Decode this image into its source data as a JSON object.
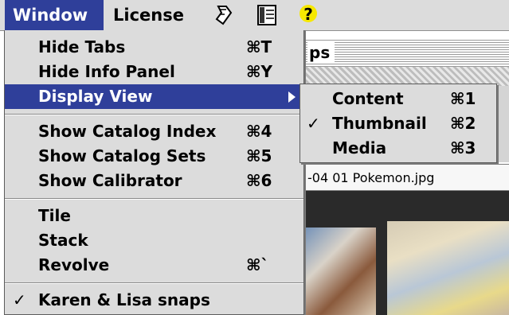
{
  "menubar": {
    "window": "Window",
    "license": "License"
  },
  "background_window": {
    "title_fragment": "ps",
    "filename": "-04 01 Pokemon.jpg"
  },
  "menu": {
    "items": [
      {
        "label": "Hide Tabs",
        "shortcut": "⌘T"
      },
      {
        "label": "Hide Info Panel",
        "shortcut": "⌘Y"
      },
      {
        "label": "Display View",
        "shortcut": ""
      },
      {
        "label": "Show Catalog Index",
        "shortcut": "⌘4"
      },
      {
        "label": "Show Catalog Sets",
        "shortcut": "⌘5"
      },
      {
        "label": "Show Calibrator",
        "shortcut": "⌘6"
      },
      {
        "label": "Tile",
        "shortcut": ""
      },
      {
        "label": "Stack",
        "shortcut": ""
      },
      {
        "label": "Revolve",
        "shortcut": "⌘`"
      },
      {
        "label": "Karen & Lisa snaps",
        "shortcut": "",
        "check": "✓"
      }
    ]
  },
  "submenu": {
    "items": [
      {
        "label": "Content",
        "shortcut": "⌘1",
        "check": ""
      },
      {
        "label": "Thumbnail",
        "shortcut": "⌘2",
        "check": "✓"
      },
      {
        "label": "Media",
        "shortcut": "⌘3",
        "check": ""
      }
    ]
  },
  "colors": {
    "highlight": "#2f3f9a",
    "menu_bg": "#dcdcdc"
  }
}
